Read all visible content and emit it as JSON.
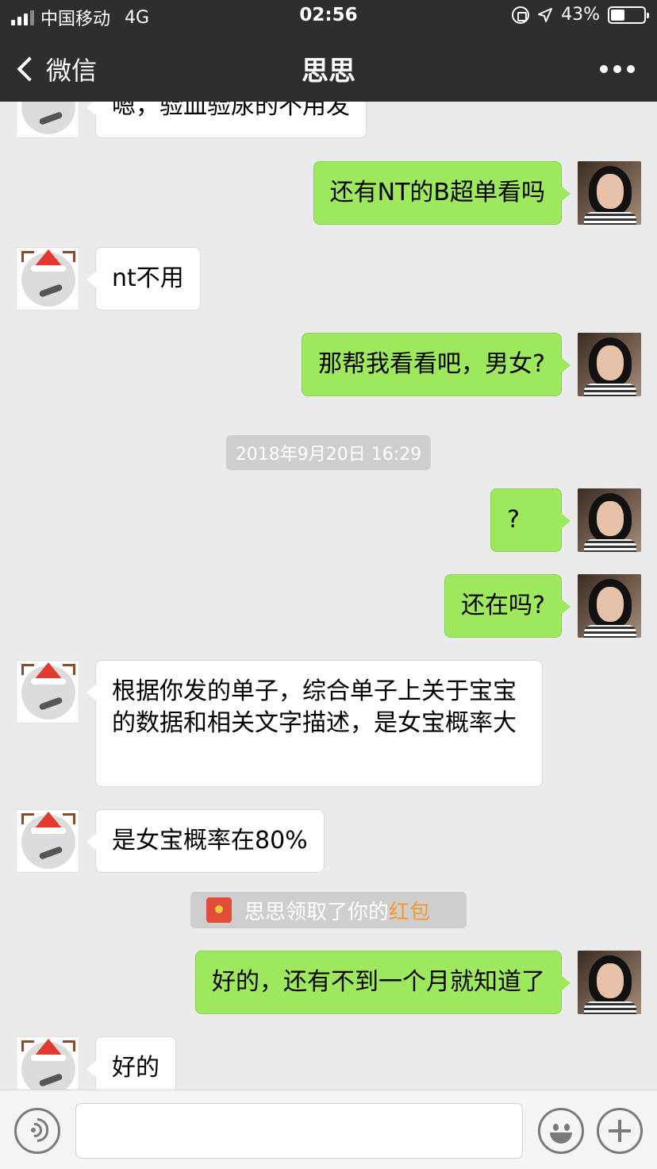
{
  "status_bar": {
    "carrier": "中国移动",
    "network": "4G",
    "time": "02:56",
    "battery_percent": "43%",
    "battery_level": 0.43
  },
  "nav": {
    "back_label": "微信",
    "title": "思思"
  },
  "messages": [
    {
      "sender": "other",
      "text": "嗯，验血验尿的不用发"
    },
    {
      "sender": "me",
      "text": "还有NT的B超单看吗"
    },
    {
      "sender": "other",
      "text": "nt不用"
    },
    {
      "sender": "me",
      "text": "那帮我看看吧，男女?"
    },
    {
      "sender": "me",
      "text": "?"
    },
    {
      "sender": "me",
      "text": "还在吗?"
    },
    {
      "sender": "other",
      "text": "根据你发的单子，综合单子上关于宝宝的数据和相关文字描述，是女宝概率大"
    },
    {
      "sender": "other",
      "text": "是女宝概率在80%"
    },
    {
      "sender": "me",
      "text": "好的，还有不到一个月就知道了"
    },
    {
      "sender": "other",
      "text": "好的"
    }
  ],
  "timestamp": "2018年9月20日 16:29",
  "red_packet_notice": {
    "text": "思思领取了你的",
    "link": "红包"
  },
  "input": {
    "value": "",
    "placeholder": ""
  },
  "icons": {
    "voice": "voice-icon",
    "emoji": "emoji-icon",
    "plus": "plus-icon"
  },
  "colors": {
    "nav_bg": "#2e2e2e",
    "chat_bg": "#ebebeb",
    "my_bubble": "#9ee85e",
    "other_bubble": "#ffffff",
    "red_packet_link": "#f59a2c"
  }
}
